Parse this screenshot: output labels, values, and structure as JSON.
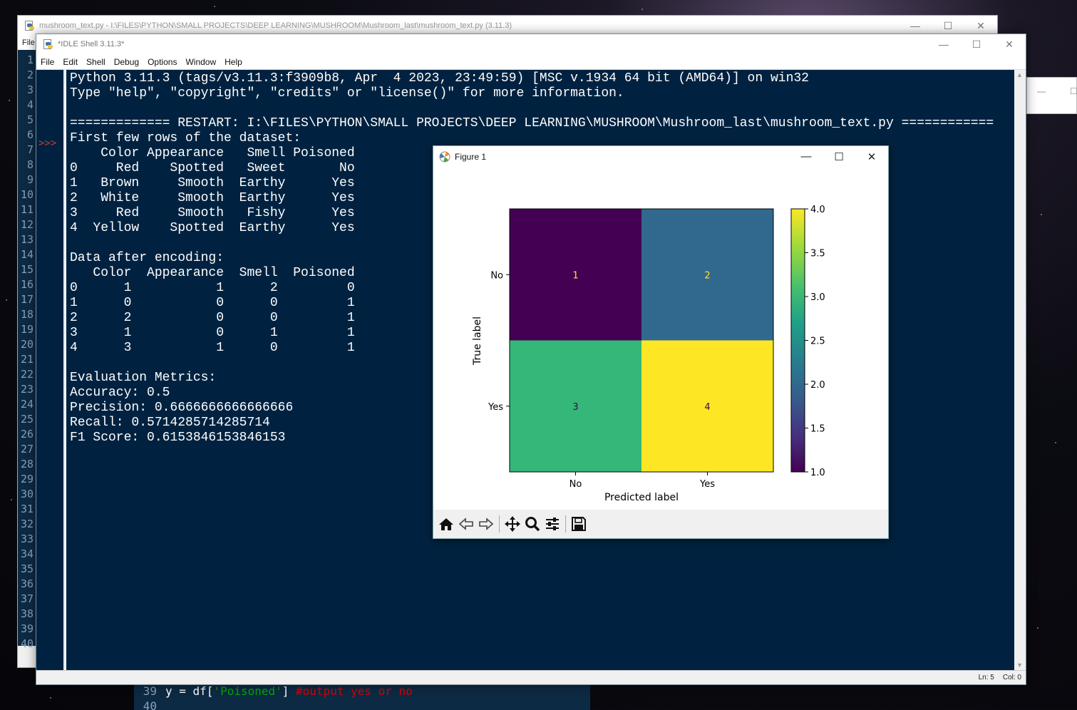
{
  "editor_window": {
    "title": "mushroom_text.py - I:\\FILES\\PYTHON\\SMALL PROJECTS\\DEEP LEARNING\\MUSHROOM\\Mushroom_last\\mushroom_text.py (3.11.3)",
    "menu_first": "File",
    "gutter_line_numbers": "1\n2\n3\n4\n5\n6\n7\n8\n9\n10\n11\n12\n13\n14\n15\n16\n17\n18\n19\n20\n21\n22\n23\n24\n25\n26\n27\n28\n29\n30\n31\n32\n33\n34\n35\n36\n37\n38\n39\n40",
    "bottom_lines": [
      {
        "number": "39",
        "pre": "y = df[",
        "string": "'Poisoned'",
        "mid": "] ",
        "comment": "#output yes or no"
      },
      {
        "number": "40",
        "pre": "",
        "string": "",
        "mid": "",
        "comment": ""
      }
    ]
  },
  "shell_window": {
    "title": "*IDLE Shell 3.11.3*",
    "menu": [
      "File",
      "Edit",
      "Shell",
      "Debug",
      "Options",
      "Window",
      "Help"
    ],
    "prompt": ">>>",
    "lines": [
      "Python 3.11.3 (tags/v3.11.3:f3909b8, Apr  4 2023, 23:49:59) [MSC v.1934 64 bit (AMD64)] on win32",
      "Type \"help\", \"copyright\", \"credits\" or \"license()\" for more information.",
      "",
      "============= RESTART: I:\\FILES\\PYTHON\\SMALL PROJECTS\\DEEP LEARNING\\MUSHROOM\\Mushroom_last\\mushroom_text.py ============",
      "First few rows of the dataset:",
      "    Color Appearance   Smell Poisoned",
      "0     Red    Spotted   Sweet       No",
      "1   Brown     Smooth  Earthy      Yes",
      "2   White     Smooth  Earthy      Yes",
      "3     Red     Smooth   Fishy      Yes",
      "4  Yellow    Spotted  Earthy      Yes",
      "",
      "Data after encoding:",
      "   Color  Appearance  Smell  Poisoned",
      "0      1           1      2         0",
      "1      0           0      0         1",
      "2      2           0      0         1",
      "3      1           0      1         1",
      "4      3           1      0         1",
      "",
      "Evaluation Metrics:",
      "Accuracy: 0.5",
      "Precision: 0.6666666666666666",
      "Recall: 0.5714285714285714",
      "F1 Score: 0.6153846153846153"
    ],
    "status_ln": "Ln: 5",
    "status_col": "Col: 0"
  },
  "figure_window": {
    "title": "Figure 1",
    "toolbar": [
      "home-icon",
      "back-icon",
      "forward-icon",
      "pan-icon",
      "zoom-icon",
      "configure-subplots-icon",
      "save-icon"
    ]
  },
  "chart_data": {
    "type": "heatmap",
    "title": "",
    "xlabel": "Predicted label",
    "ylabel": "True label",
    "x_categories": [
      "No",
      "Yes"
    ],
    "y_categories": [
      "No",
      "Yes"
    ],
    "values": [
      [
        1,
        2
      ],
      [
        3,
        4
      ]
    ],
    "colormap": "viridis",
    "colorbar": {
      "min": 1.0,
      "max": 4.0,
      "ticks": [
        "1.0",
        "1.5",
        "2.0",
        "2.5",
        "3.0",
        "3.5",
        "4.0"
      ]
    },
    "cell_colors": {
      "1": "#440154",
      "2": "#31688e",
      "3": "#35b779",
      "4": "#fde725"
    },
    "cell_text_colors": {
      "1": "#fde725",
      "2": "#fde725",
      "3": "#440154",
      "4": "#440154"
    }
  }
}
